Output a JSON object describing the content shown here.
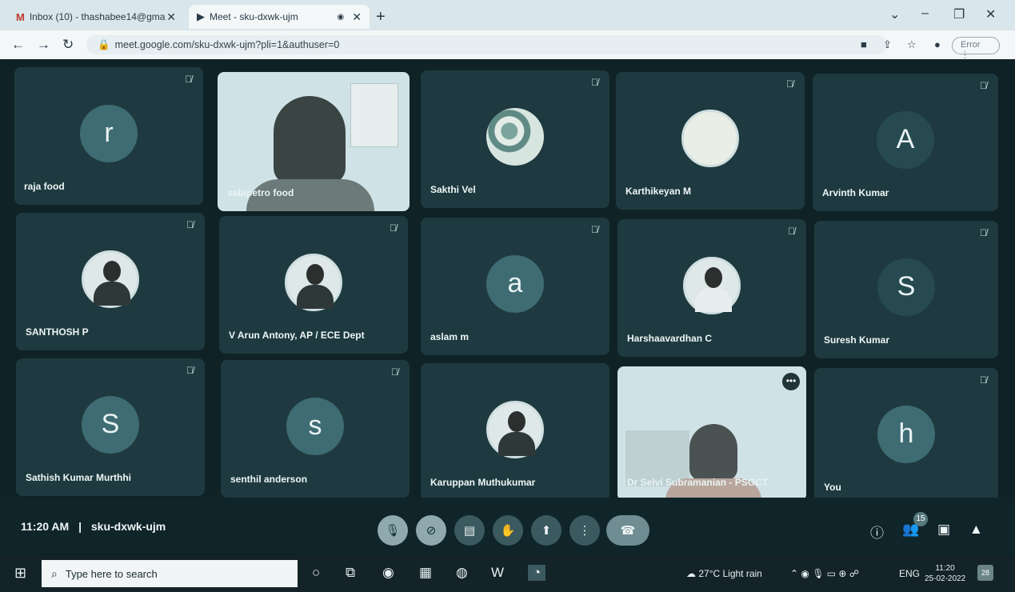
{
  "browser": {
    "tabs": [
      {
        "icon": "gmail-icon",
        "glyph": "M",
        "label": "Inbox (10) - thashabee14@gma"
      },
      {
        "icon": "meet-icon",
        "glyph": "▶",
        "label": "Meet - sku-dxwk-ujm"
      }
    ],
    "url": "meet.google.com/sku-dxwk-ujm?pli=1&authuser=0",
    "error_label": "Error"
  },
  "participants": [
    {
      "name": "raja food",
      "initial": "r",
      "avatar": "letter"
    },
    {
      "name": "sabipetro food",
      "initial": "",
      "avatar": "video"
    },
    {
      "name": "Sakthi Vel",
      "initial": "",
      "avatar": "floral"
    },
    {
      "name": "Karthikeyan M",
      "initial": "",
      "avatar": "sketch"
    },
    {
      "name": "Arvinth Kumar",
      "initial": "A",
      "avatar": "letter-dark"
    },
    {
      "name": "SANTHOSH P",
      "initial": "",
      "avatar": "photo"
    },
    {
      "name": "V Arun Antony, AP / ECE Dept",
      "initial": "",
      "avatar": "photo"
    },
    {
      "name": "aslam m",
      "initial": "a",
      "avatar": "letter"
    },
    {
      "name": "Harshaavardhan C",
      "initial": "",
      "avatar": "photo"
    },
    {
      "name": "Suresh Kumar",
      "initial": "S",
      "avatar": "letter-dark"
    },
    {
      "name": "Sathish Kumar Murthhi",
      "initial": "S",
      "avatar": "letter"
    },
    {
      "name": "senthil anderson",
      "initial": "s",
      "avatar": "letter"
    },
    {
      "name": "Karuppan Muthukumar",
      "initial": "",
      "avatar": "photo"
    },
    {
      "name": "Dr Selvi Subramanian - PSGCT",
      "initial": "",
      "avatar": "video2"
    },
    {
      "name": "You",
      "initial": "h",
      "avatar": "letter"
    }
  ],
  "meeting": {
    "time": "11:20 AM",
    "separator": "|",
    "code": "sku-dxwk-ujm",
    "participant_count": "15"
  },
  "taskbar": {
    "search_placeholder": "Type here to search",
    "weather": "27°C  Light rain",
    "language": "ENG",
    "time": "11:20",
    "date": "25-02-2022",
    "notifications": "28"
  }
}
